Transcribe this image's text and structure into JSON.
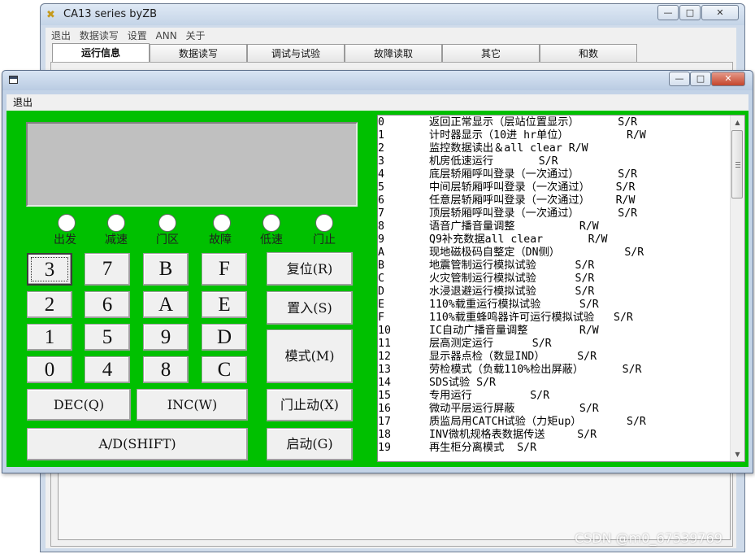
{
  "main_window": {
    "title": "CA13 series byZB",
    "controls": {
      "minimize": "—",
      "maximize": "□",
      "close": "✕"
    },
    "menu": [
      "退出",
      "数据读写",
      "设置",
      "ANN",
      "关于"
    ],
    "tabs": [
      "运行信息",
      "数据读写",
      "调试与试验",
      "故障读取",
      "其它",
      "和数"
    ],
    "active_tab": "运行信息"
  },
  "child_window": {
    "controls": {
      "minimize": "—",
      "maximize": "□",
      "close": "✕"
    },
    "menu": [
      "退出"
    ],
    "panel_color": "#00c000",
    "display_text": "",
    "leds": [
      "出发",
      "减速",
      "门区",
      "故障",
      "低速",
      "门止"
    ],
    "keys": {
      "k3": "3",
      "k7": "7",
      "kB": "B",
      "kF": "F",
      "k2": "2",
      "k6": "6",
      "kA": "A",
      "kE": "E",
      "k1": "1",
      "k5": "5",
      "k9": "9",
      "kD": "D",
      "k0": "0",
      "k4": "4",
      "k8": "8",
      "kC": "C",
      "dec": "DEC(Q)",
      "inc": "INC(W)",
      "ad": "A/D(SHIFT)",
      "reset": "复位(R)",
      "set": "置入(S)",
      "mode": "模式(M)",
      "door_stop": "门止动(X)",
      "start": "启动(G)"
    },
    "function_list": [
      {
        "code": "0",
        "desc": "返回正常显示（层站位置显示）      S/R"
      },
      {
        "code": "1",
        "desc": "计时器显示（10进 hr单位）         R/W"
      },
      {
        "code": "2",
        "desc": "监控数据读出＆all clear R/W"
      },
      {
        "code": "3",
        "desc": "机房低速运行       S/R"
      },
      {
        "code": "4",
        "desc": "底层轿厢呼叫登录（一次通过）      S/R"
      },
      {
        "code": "5",
        "desc": "中间层轿厢呼叫登录（一次通过）    S/R"
      },
      {
        "code": "6",
        "desc": "任意层轿厢呼叫登录（一次通过）    R/W"
      },
      {
        "code": "7",
        "desc": "顶层轿厢呼叫登录（一次通过）      S/R"
      },
      {
        "code": "8",
        "desc": "语音广播音量调整          R/W"
      },
      {
        "code": "9",
        "desc": "Q9补充数据all clear       R/W"
      },
      {
        "code": "A",
        "desc": "现地磁极码自整定（DN侧）          S/R"
      },
      {
        "code": "B",
        "desc": "地震管制运行模拟试验      S/R"
      },
      {
        "code": "C",
        "desc": "火灾管制运行模拟试验      S/R"
      },
      {
        "code": "D",
        "desc": "水浸退避运行模拟试验      S/R"
      },
      {
        "code": "E",
        "desc": "110%载重运行模拟试验      S/R"
      },
      {
        "code": "F",
        "desc": "110%载重蜂鸣器许可运行模拟试验   S/R"
      },
      {
        "code": "10",
        "desc": "IC自动广播音量调整        R/W"
      },
      {
        "code": "11",
        "desc": "层高测定运行      S/R"
      },
      {
        "code": "12",
        "desc": "显示器点检（数显IND）     S/R"
      },
      {
        "code": "13",
        "desc": "劳检模式（负载110%检出屏蔽）      S/R"
      },
      {
        "code": "14",
        "desc": "SDS试验 S/R"
      },
      {
        "code": "15",
        "desc": "专用运行         S/R"
      },
      {
        "code": "16",
        "desc": "微动平层运行屏蔽          S/R"
      },
      {
        "code": "17",
        "desc": "质监局用CATCH试验（力矩up）       S/R"
      },
      {
        "code": "18",
        "desc": "INV微机规格表数据传送     S/R"
      },
      {
        "code": "19",
        "desc": "再生柜分离模式  S/R"
      }
    ]
  },
  "watermark": "CSDN @m0_67539769"
}
